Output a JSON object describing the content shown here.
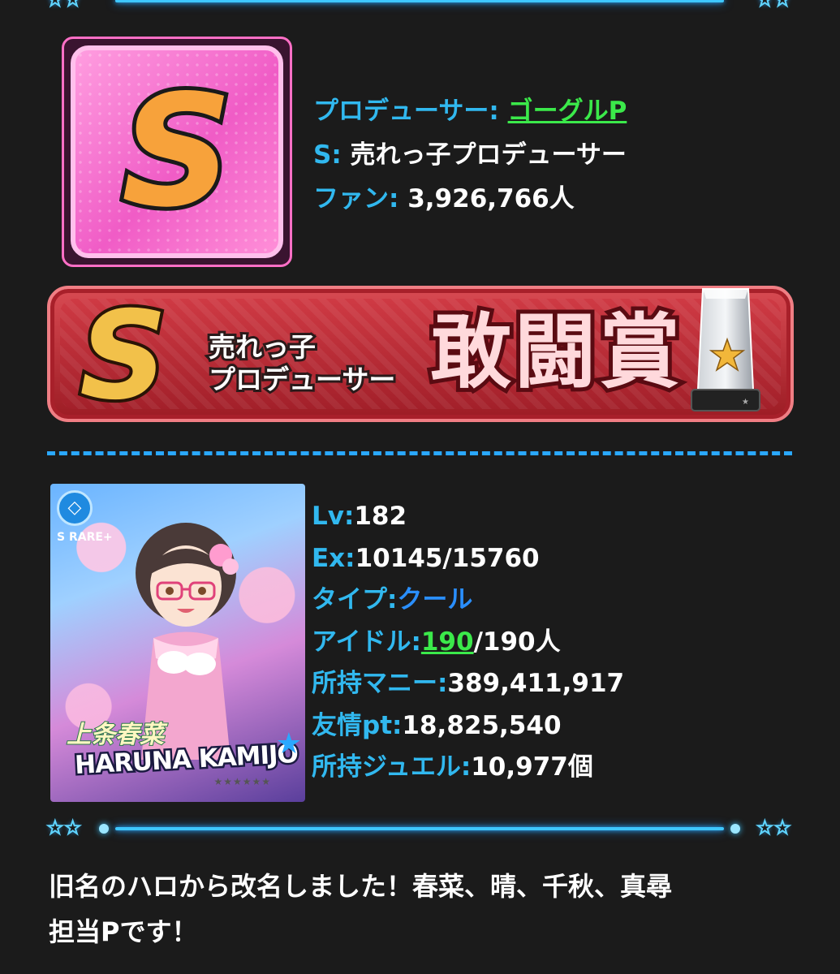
{
  "profile": {
    "producer_label": "プロデューサー:",
    "producer_name": "ゴーグルP",
    "rank_label": "S:",
    "rank_title": "売れっ子プロデューサー",
    "fans_label": "ファン:",
    "fans_value": "3,926,766人",
    "rank_letter": "S"
  },
  "award_banner": {
    "rank_letter": "S",
    "subtitle_line1": "売れっ子",
    "subtitle_line2": "プロデューサー",
    "award_name": "敢闘賞"
  },
  "idol_card": {
    "rarity": "S RARE+",
    "name_jp": "上条春菜",
    "name_en": "HARUNA KAMIJO"
  },
  "stats": {
    "lv_label": "Lv:",
    "lv_value": "182",
    "ex_label": "Ex:",
    "ex_value": "10145/15760",
    "type_label": "タイプ:",
    "type_value": "クール",
    "idol_label": "アイドル:",
    "idol_count": "190",
    "idol_total": "/190人",
    "money_label": "所持マニー:",
    "money_value": "389,411,917",
    "friend_label": "友情pt:",
    "friend_value": "18,825,540",
    "jewel_label": "所持ジュエル:",
    "jewel_value": "10,977個"
  },
  "bio": {
    "line1": "旧名のハロから改名しました！春菜、晴、千秋、真尋",
    "line2": "担当Pです！"
  },
  "colors": {
    "label_blue": "#31b8ef",
    "link_green": "#3be94a",
    "cool_blue": "#2a8fff",
    "background": "#1b1b1b"
  }
}
